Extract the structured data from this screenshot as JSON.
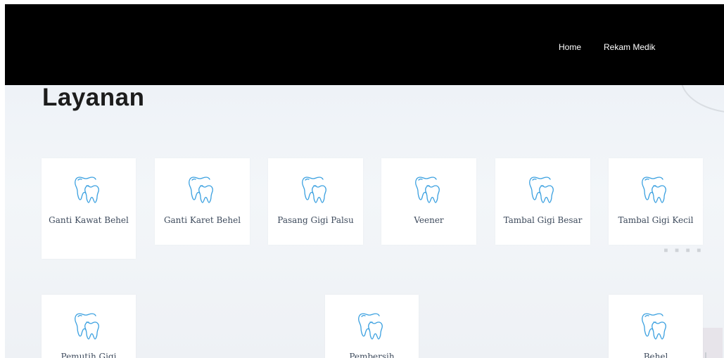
{
  "nav": {
    "items": [
      {
        "label": "Home"
      },
      {
        "label": "Rekam Medik"
      }
    ]
  },
  "page": {
    "title": "Layanan"
  },
  "services": [
    {
      "label": "Ganti Kawat Behel",
      "icon": "tooth-icon"
    },
    {
      "label": "Ganti Karet Behel",
      "icon": "tooth-icon"
    },
    {
      "label": "Pasang Gigi Palsu",
      "icon": "tooth-icon"
    },
    {
      "label": "Veener",
      "icon": "tooth-icon"
    },
    {
      "label": "Tambal Gigi Besar",
      "icon": "tooth-icon"
    },
    {
      "label": "Tambal Gigi Kecil",
      "icon": "tooth-icon"
    },
    {
      "label": "Pemutih Gigi",
      "icon": "tooth-icon"
    },
    {
      "label": "Pembersih",
      "icon": "tooth-icon"
    },
    {
      "label": "Behel",
      "icon": "tooth-icon"
    }
  ],
  "colors": {
    "navbar": "#000000",
    "icon_stroke": "#3aa0e0",
    "card_text": "#3d4a5c",
    "title": "#1c1c1c"
  }
}
